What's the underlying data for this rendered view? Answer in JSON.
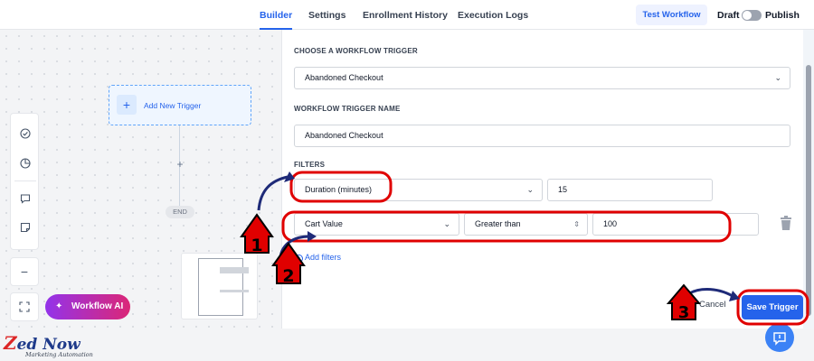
{
  "header": {
    "tabs": [
      {
        "label": "Builder",
        "active": true
      },
      {
        "label": "Settings",
        "active": false
      },
      {
        "label": "Enrollment History",
        "active": false
      },
      {
        "label": "Execution Logs",
        "active": false
      }
    ],
    "test_workflow_label": "Test Workflow",
    "draft_label": "Draft",
    "publish_label": "Publish",
    "publish_toggle_on": false
  },
  "canvas": {
    "trigger_node_label": "Add New Trigger",
    "add_node_symbol": "+",
    "end_label": "END",
    "workflow_ai_label": "Workflow AI",
    "toolbar_icons": [
      "check-circle-icon",
      "pie-chart-icon",
      "comment-icon",
      "sticky-note-icon",
      "zoom-out-icon",
      "expand-icon"
    ]
  },
  "panel": {
    "choose_trigger_label": "CHOOSE A WORKFLOW TRIGGER",
    "trigger_select_value": "Abandoned Checkout",
    "trigger_name_label": "WORKFLOW TRIGGER NAME",
    "trigger_name_value": "Abandoned Checkout",
    "filters_label": "FILTERS",
    "filters": [
      {
        "field": "Duration (minutes)",
        "value": "15"
      },
      {
        "field": "Cart Value",
        "operator": "Greater than",
        "value": "100"
      }
    ],
    "add_filters_label": "Add filters",
    "cancel_label": "Cancel",
    "save_label": "Save Trigger"
  },
  "annotations": {
    "step_1": "1",
    "step_2": "2",
    "step_3": "3",
    "highlight_color": "#e00000",
    "arrow_color": "#1e2a78"
  },
  "branding": {
    "logo_main_first": "Z",
    "logo_main_rest": "ed Now",
    "logo_sub": "Marketing Automation"
  },
  "colors": {
    "primary": "#2563eb",
    "ai_gradient_start": "#9333ea",
    "ai_gradient_end": "#db2777"
  }
}
